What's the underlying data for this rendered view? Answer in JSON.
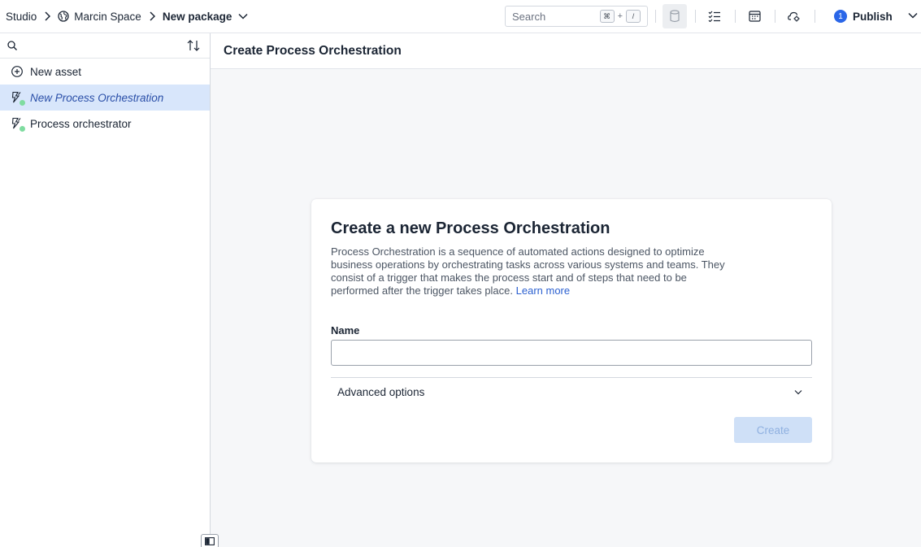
{
  "breadcrumb": {
    "items": [
      "Studio",
      "Marcin Space",
      "New package"
    ]
  },
  "search": {
    "placeholder": "Search",
    "shortcut_key1": "⌘",
    "shortcut_plus": "+",
    "shortcut_key2": "/"
  },
  "toolbar": {
    "icons": [
      "database-icon",
      "checklist-icon",
      "calendar-icon",
      "cloud-settings-icon"
    ]
  },
  "publish": {
    "count": "1",
    "label": "Publish"
  },
  "sidebar": {
    "search_placeholder": "",
    "items": [
      {
        "label": "New asset",
        "icon": "add-circle-icon"
      },
      {
        "label": "New Process Orchestration",
        "icon": "process-orchestration-icon",
        "selected": true
      },
      {
        "label": "Process orchestrator",
        "icon": "process-orchestration-icon"
      }
    ]
  },
  "main": {
    "title": "Create Process Orchestration"
  },
  "card": {
    "title": "Create a new Process Orchestration",
    "description": "Process Orchestration is a sequence of automated actions designed to optimize business operations by orchestrating tasks across various systems and teams. They consist of a trigger that makes the process start and of steps that need to be performed after the trigger takes place. ",
    "learn_more": "Learn more",
    "name_label": "Name",
    "name_value": "",
    "advanced_label": "Advanced options",
    "create_label": "Create"
  },
  "colors": {
    "accent": "#2a66e8",
    "selected_bg": "#d8e6fb",
    "status_dot": "#7fdca0",
    "create_disabled_bg": "#cfe0f7"
  }
}
